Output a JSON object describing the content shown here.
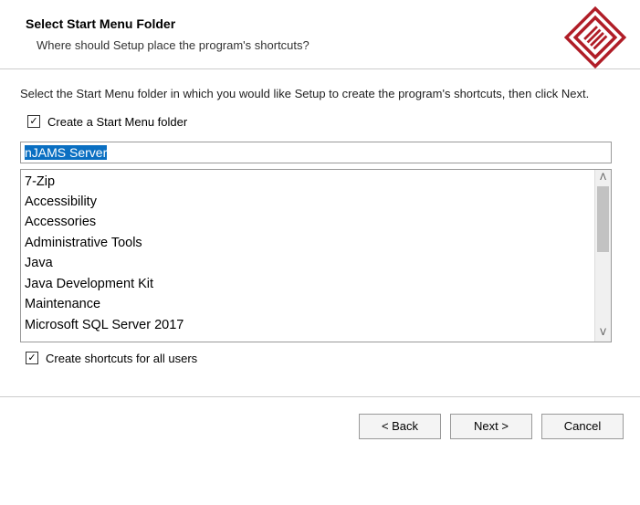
{
  "header": {
    "title": "Select Start Menu Folder",
    "subtitle": "Where should Setup place the program's shortcuts?"
  },
  "content": {
    "instruction": "Select the Start Menu folder in which you would like Setup to create the program's shortcuts, then click Next.",
    "checkbox_create_folder_label": "Create a Start Menu folder",
    "checkbox_create_folder_checked": true,
    "folder_name_value": "nJAMS Server",
    "folder_list": [
      "7-Zip",
      "Accessibility",
      "Accessories",
      "Administrative Tools",
      "Java",
      "Java Development Kit",
      "Maintenance",
      "Microsoft SQL Server 2017"
    ],
    "checkbox_all_users_label": "Create shortcuts for all users",
    "checkbox_all_users_checked": true
  },
  "footer": {
    "back_label": "< Back",
    "next_label": "Next >",
    "cancel_label": "Cancel"
  },
  "icons": {
    "check_glyph": "✓",
    "scroll_up": "ᐱ",
    "scroll_down": "ᐯ"
  },
  "colors": {
    "accent": "#b01d27",
    "selection_bg": "#0a6fc2"
  }
}
